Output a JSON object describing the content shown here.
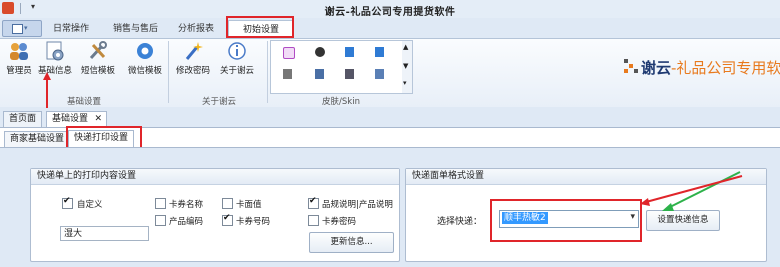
{
  "window": {
    "title": "谢云-礼品公司专用提货软件",
    "quick_access_drop": "▾"
  },
  "ribbon_tabs": [
    "日常操作",
    "销售与售后",
    "分析报表",
    "初始设置"
  ],
  "ribbon": {
    "groups": [
      {
        "label": "基础设置",
        "buttons": [
          "管理员",
          "基础信息",
          "短信模板",
          "微信模板"
        ]
      },
      {
        "label": "关于谢云",
        "buttons": [
          "修改密码",
          "关于谢云"
        ]
      },
      {
        "label": "皮肤/Skin"
      }
    ],
    "brand_dark": "谢云",
    "brand_rest": "-礼品公司专用软"
  },
  "doc_tabs": [
    "首页面",
    "基础设置"
  ],
  "doc_tab_close": "✕",
  "sub_tabs": [
    "商家基础设置",
    "快递打印设置"
  ],
  "print_group": {
    "title": "快递单上的打印内容设置",
    "checkboxes": [
      {
        "label": "自定义",
        "checked": true
      },
      {
        "label": "卡券名称",
        "checked": false
      },
      {
        "label": "产品编码",
        "checked": false
      },
      {
        "label": "卡面值",
        "checked": false
      },
      {
        "label": "卡券号码",
        "checked": true
      },
      {
        "label": "品规说明|产品说明",
        "checked": true
      },
      {
        "label": "卡券密码",
        "checked": false
      }
    ],
    "custom_value": "湿大",
    "update_button": "更新信息..."
  },
  "format_group": {
    "title": "快递面单格式设置",
    "select_label": "选择快递：",
    "select_value": "顺丰热敏2",
    "save_button": "设置快递信息"
  },
  "colors": {
    "highlight_red": "#e0252a",
    "arrow_green": "#2db24a",
    "accent_blue": "#3399ff"
  }
}
